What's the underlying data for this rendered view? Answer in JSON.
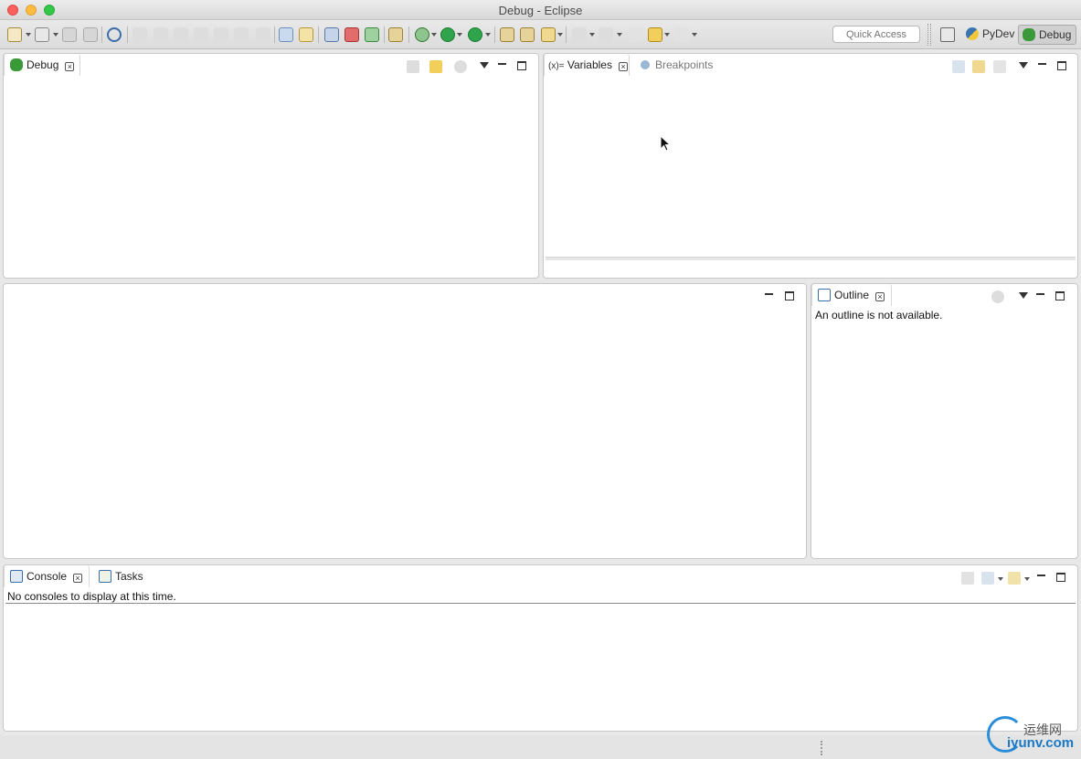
{
  "window": {
    "title": "Debug - Eclipse"
  },
  "toolbar": {
    "quick_access_placeholder": "Quick Access",
    "perspectives": [
      {
        "label": "PyDev",
        "icon": "python-icon",
        "active": false
      },
      {
        "label": "Debug",
        "icon": "bug-icon",
        "active": true
      }
    ]
  },
  "debug_view": {
    "tab_label": "Debug"
  },
  "variables_view": {
    "tabs": [
      {
        "label": "Variables",
        "prefix": "(x)=",
        "active": true
      },
      {
        "label": "Breakpoints",
        "active": false
      }
    ]
  },
  "outline_view": {
    "tab_label": "Outline",
    "message": "An outline is not available."
  },
  "bottom_view": {
    "tabs": [
      {
        "label": "Console",
        "active": true
      },
      {
        "label": "Tasks",
        "active": false
      }
    ],
    "message": "No consoles to display at this time."
  },
  "watermark": {
    "cn": "运维网",
    "en": "iyunv.com"
  },
  "colors": {
    "accent_blue": "#2a8fd8",
    "bug_green": "#3a9a3a"
  }
}
